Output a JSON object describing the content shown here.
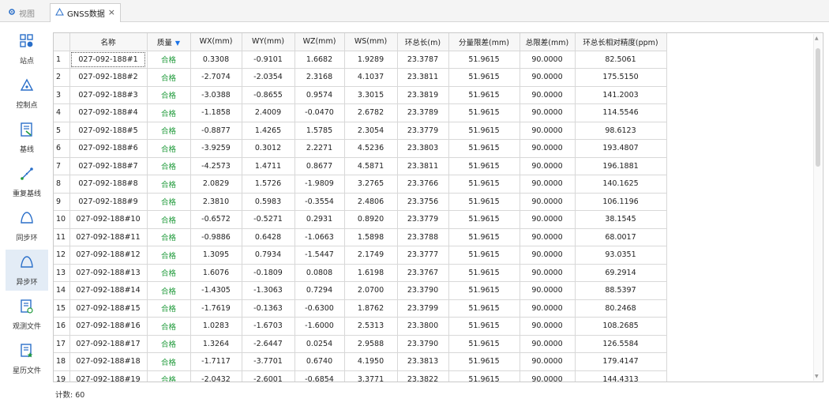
{
  "tabs": [
    {
      "label": "视图",
      "icon": "gear-icon"
    },
    {
      "label": "GNSS数据",
      "icon": "triangle-loop-icon",
      "close": "×"
    }
  ],
  "sidebar": {
    "items": [
      {
        "label": "站点",
        "icon": "site-grid-icon"
      },
      {
        "label": "控制点",
        "icon": "control-point-icon"
      },
      {
        "label": "基线",
        "icon": "baseline-doc-icon"
      },
      {
        "label": "重复基线",
        "icon": "repeat-baseline-icon"
      },
      {
        "label": "同步环",
        "icon": "sync-loop-icon"
      },
      {
        "label": "异步环",
        "icon": "async-loop-icon",
        "active": true
      },
      {
        "label": "观测文件",
        "icon": "observation-file-icon"
      },
      {
        "label": "星历文件",
        "icon": "ephemeris-file-icon"
      }
    ]
  },
  "table": {
    "columns": [
      "",
      "名称",
      "质量",
      "WX(mm)",
      "WY(mm)",
      "WZ(mm)",
      "WS(mm)",
      "环总长(m)",
      "分量限差(mm)",
      "总限差(mm)",
      "环总长相对精度(ppm)"
    ],
    "filter_arrow": "▼",
    "rows": [
      [
        "1",
        "027-092-188#1",
        "合格",
        "0.3308",
        "-0.9101",
        "1.6682",
        "1.9289",
        "23.3787",
        "51.9615",
        "90.0000",
        "82.5061"
      ],
      [
        "2",
        "027-092-188#2",
        "合格",
        "-2.7074",
        "-2.0354",
        "2.3168",
        "4.1037",
        "23.3811",
        "51.9615",
        "90.0000",
        "175.5150"
      ],
      [
        "3",
        "027-092-188#3",
        "合格",
        "-3.0388",
        "-0.8655",
        "0.9574",
        "3.3015",
        "23.3819",
        "51.9615",
        "90.0000",
        "141.2003"
      ],
      [
        "4",
        "027-092-188#4",
        "合格",
        "-1.1858",
        "2.4009",
        "-0.0470",
        "2.6782",
        "23.3789",
        "51.9615",
        "90.0000",
        "114.5546"
      ],
      [
        "5",
        "027-092-188#5",
        "合格",
        "-0.8877",
        "1.4265",
        "1.5785",
        "2.3054",
        "23.3779",
        "51.9615",
        "90.0000",
        "98.6123"
      ],
      [
        "6",
        "027-092-188#6",
        "合格",
        "-3.9259",
        "0.3012",
        "2.2271",
        "4.5236",
        "23.3803",
        "51.9615",
        "90.0000",
        "193.4807"
      ],
      [
        "7",
        "027-092-188#7",
        "合格",
        "-4.2573",
        "1.4711",
        "0.8677",
        "4.5871",
        "23.3811",
        "51.9615",
        "90.0000",
        "196.1881"
      ],
      [
        "8",
        "027-092-188#8",
        "合格",
        "2.0829",
        "1.5726",
        "-1.9809",
        "3.2765",
        "23.3766",
        "51.9615",
        "90.0000",
        "140.1625"
      ],
      [
        "9",
        "027-092-188#9",
        "合格",
        "2.3810",
        "0.5983",
        "-0.3554",
        "2.4806",
        "23.3756",
        "51.9615",
        "90.0000",
        "106.1196"
      ],
      [
        "10",
        "027-092-188#10",
        "合格",
        "-0.6572",
        "-0.5271",
        "0.2931",
        "0.8920",
        "23.3779",
        "51.9615",
        "90.0000",
        "38.1545"
      ],
      [
        "11",
        "027-092-188#11",
        "合格",
        "-0.9886",
        "0.6428",
        "-1.0663",
        "1.5898",
        "23.3788",
        "51.9615",
        "90.0000",
        "68.0017"
      ],
      [
        "12",
        "027-092-188#12",
        "合格",
        "1.3095",
        "0.7934",
        "-1.5447",
        "2.1749",
        "23.3777",
        "51.9615",
        "90.0000",
        "93.0351"
      ],
      [
        "13",
        "027-092-188#13",
        "合格",
        "1.6076",
        "-0.1809",
        "0.0808",
        "1.6198",
        "23.3767",
        "51.9615",
        "90.0000",
        "69.2914"
      ],
      [
        "14",
        "027-092-188#14",
        "合格",
        "-1.4305",
        "-1.3063",
        "0.7294",
        "2.0700",
        "23.3790",
        "51.9615",
        "90.0000",
        "88.5397"
      ],
      [
        "15",
        "027-092-188#15",
        "合格",
        "-1.7619",
        "-0.1363",
        "-0.6300",
        "1.8762",
        "23.3799",
        "51.9615",
        "90.0000",
        "80.2468"
      ],
      [
        "16",
        "027-092-188#16",
        "合格",
        "1.0283",
        "-1.6703",
        "-1.6000",
        "2.5313",
        "23.3800",
        "51.9615",
        "90.0000",
        "108.2685"
      ],
      [
        "17",
        "027-092-188#17",
        "合格",
        "1.3264",
        "-2.6447",
        "0.0254",
        "2.9588",
        "23.3790",
        "51.9615",
        "90.0000",
        "126.5584"
      ],
      [
        "18",
        "027-092-188#18",
        "合格",
        "-1.7117",
        "-3.7701",
        "0.6740",
        "4.1950",
        "23.3813",
        "51.9615",
        "90.0000",
        "179.4147"
      ],
      [
        "19",
        "027-092-188#19",
        "合格",
        "-2.0432",
        "-2.6001",
        "-0.6854",
        "3.3771",
        "23.3822",
        "51.9615",
        "90.0000",
        "144.4313"
      ]
    ]
  },
  "status": {
    "count_label": "计数: 60"
  },
  "colors": {
    "quality_pass": "#1f9a3a",
    "accent": "#1a73e8",
    "active_sidebar": "#e3ecf6"
  }
}
